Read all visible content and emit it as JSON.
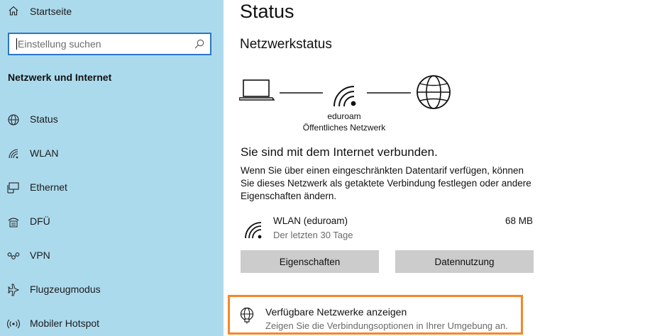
{
  "sidebar": {
    "home_label": "Startseite",
    "search_placeholder": "Einstellung suchen",
    "section_title": "Netzwerk und Internet",
    "items": [
      {
        "label": "Status",
        "icon": "status-globe-icon"
      },
      {
        "label": "WLAN",
        "icon": "wifi-icon"
      },
      {
        "label": "Ethernet",
        "icon": "ethernet-icon"
      },
      {
        "label": "DFÜ",
        "icon": "dialup-icon"
      },
      {
        "label": "VPN",
        "icon": "vpn-icon"
      },
      {
        "label": "Flugzeugmodus",
        "icon": "airplane-icon"
      },
      {
        "label": "Mobiler Hotspot",
        "icon": "hotspot-icon"
      }
    ]
  },
  "main": {
    "title": "Status",
    "network_status_heading": "Netzwerkstatus",
    "network_name": "eduroam",
    "network_type": "Öffentliches Netzwerk",
    "connected_text": "Sie sind mit dem Internet verbunden.",
    "description": "Wenn Sie über einen eingeschränkten Datentarif verfügen, können Sie dieses Netzwerk als getaktete Verbindung festlegen oder andere Eigenschaften ändern.",
    "usage": {
      "name": "WLAN (eduroam)",
      "period": "Der letzten 30 Tage",
      "amount": "68 MB"
    },
    "buttons": {
      "properties": "Eigenschaften",
      "data_usage": "Datennutzung"
    },
    "available_networks": {
      "title": "Verfügbare Netzwerke anzeigen",
      "subtitle": "Zeigen Sie die Verbindungsoptionen in Ihrer Umgebung an."
    }
  },
  "colors": {
    "sidebar_bg": "#acdaed",
    "search_border": "#2b76c6",
    "highlight_border": "#f5862a",
    "button_bg": "#cccccc"
  }
}
